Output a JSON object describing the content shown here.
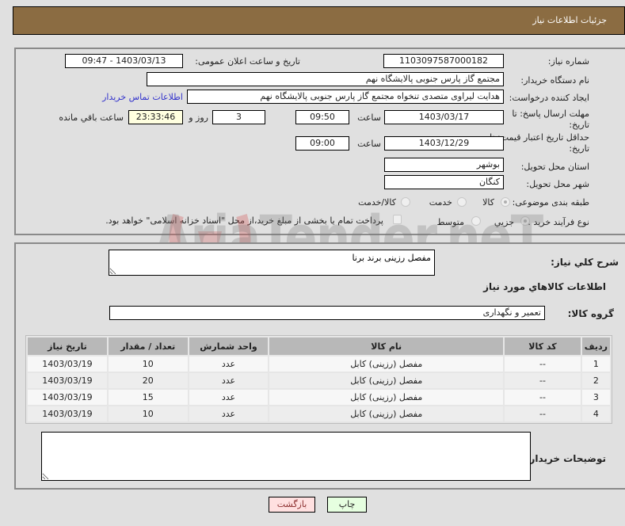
{
  "header": {
    "title": "جزئیات اطلاعات نیاز"
  },
  "form": {
    "need_number": {
      "label": "شماره نیاز:",
      "value": "1103097587000182"
    },
    "announce": {
      "label": "تاریخ و ساعت اعلان عمومی:",
      "value": "1403/03/13 - 09:47"
    },
    "buyer_org": {
      "label": "نام دستگاه خریدار:",
      "value": "مجتمع گاز پارس جنوبی  پالایشگاه نهم"
    },
    "creator": {
      "label": "ایجاد کننده درخواست:",
      "value": "هدایت لیراوی متصدی تنخواه مجتمع گاز پارس جنوبی  پالایشگاه نهم",
      "contact_link": "اطلاعات تماس خریدار"
    },
    "reply_deadline": {
      "label_line1": "مهلت ارسال پاسخ: تا",
      "label_line2": "تاریخ:",
      "date": "1403/03/17",
      "time_label": "ساعت",
      "time": "09:50",
      "days": "3",
      "days_label": "روز و",
      "remaining": "23:33:46",
      "remaining_label": "ساعت باقي مانده"
    },
    "price_validity": {
      "label_line1": "حداقل تاریخ اعتبار قیمت: تا",
      "label_line2": "تاریخ:",
      "date": "1403/12/29",
      "time_label": "ساعت",
      "time": "09:00"
    },
    "province": {
      "label": "استان محل تحویل:",
      "value": "بوشهر"
    },
    "city": {
      "label": "شهر محل تحویل:",
      "value": "کنگان"
    },
    "category": {
      "label": "طبقه بندی موضوعی:",
      "options": [
        "کالا",
        "خدمت",
        "کالا/خدمت"
      ],
      "selected": "کالا"
    },
    "purchase_type": {
      "label": "نوع فرآیند خرید :",
      "options": [
        "جزیي",
        "متوسط"
      ],
      "selected": "جزیي",
      "checkbox_label": "پرداخت تمام یا بخشی از مبلغ خرید،از محل \"اسناد خزانه اسلامی\" خواهد بود."
    }
  },
  "details": {
    "description_label": "شرح کلي نیاز:",
    "description_value": "مفصل رزینی برند برنا",
    "goods_info_title": "اطلاعات کالاهاي مورد نیاز",
    "goods_group_label": "گروه کالا:",
    "goods_group_value": "تعمیر و نگهداری",
    "table": {
      "headers": [
        "ردیف",
        "کد کالا",
        "نام کالا",
        "واحد شمارش",
        "تعداد / مقدار",
        "تاریخ نیاز"
      ],
      "rows": [
        [
          "1",
          "--",
          "مفصل (رزینی) کابل",
          "عدد",
          "10",
          "1403/03/19"
        ],
        [
          "2",
          "--",
          "مفصل (رزینی) کابل",
          "عدد",
          "20",
          "1403/03/19"
        ],
        [
          "3",
          "--",
          "مفصل (رزینی) کابل",
          "عدد",
          "15",
          "1403/03/19"
        ],
        [
          "4",
          "--",
          "مفصل (رزینی) کابل",
          "عدد",
          "10",
          "1403/03/19"
        ]
      ]
    },
    "buyer_notes_label": "توضیحات خریدار:",
    "buyer_notes_value": ""
  },
  "buttons": {
    "print": "چاپ",
    "back": "بازگشت"
  },
  "watermark": {
    "text": "AriaTender.neT"
  }
}
